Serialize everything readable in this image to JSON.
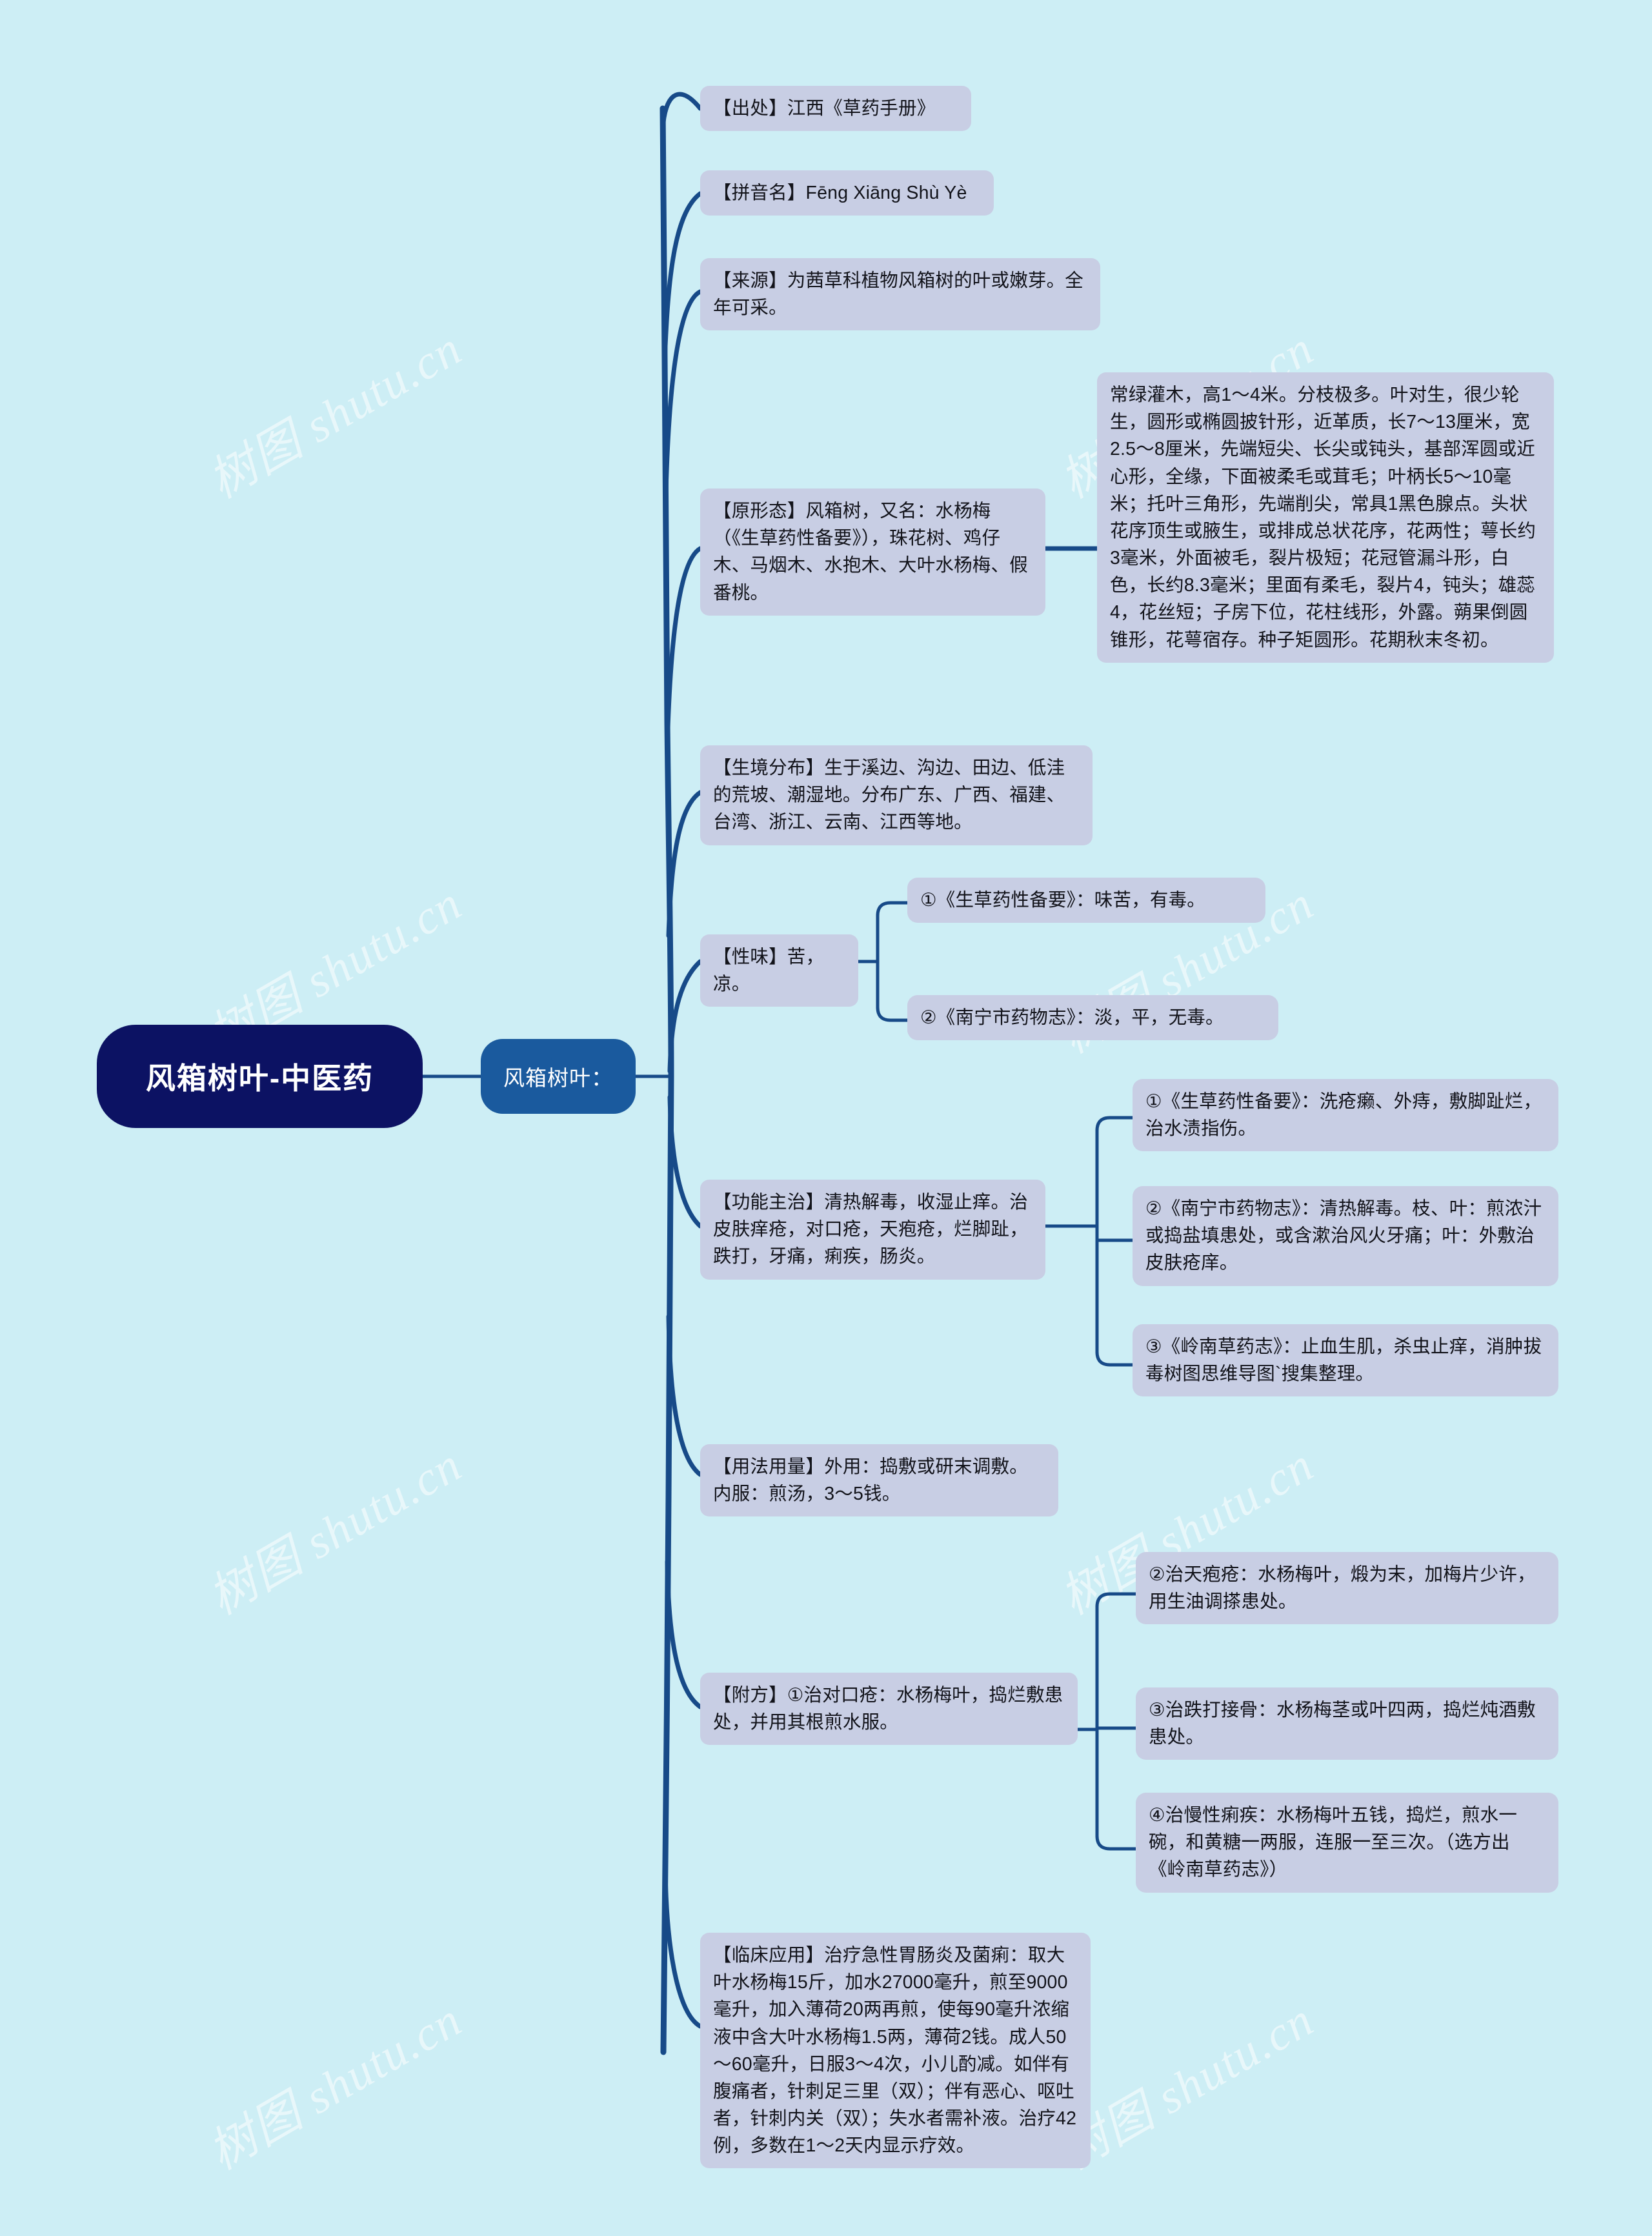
{
  "root": {
    "label": "风箱树叶-中医药"
  },
  "branch": {
    "label": "风箱树叶："
  },
  "watermarks": [
    "树图 shutu.cn",
    "树图 shutu.cn",
    "树图 shutu.cn",
    "树图 shutu.cn",
    "树图 shutu.cn",
    "树图 shutu.cn",
    "树图 shutu.cn",
    "树图 shutu.cn"
  ],
  "colors": {
    "background": "#cdeef5",
    "root_fill": "#0c1263",
    "branch_fill": "#1a5a9e",
    "node_fill": "#c8cee4",
    "link_stroke": "#174a88",
    "text": "#12131a"
  },
  "nodes": {
    "chuchu": "【出处】江西《草药手册》",
    "pinyin": "【拼音名】Fēng Xiāng Shù Yè",
    "laiyuan": "【来源】为茜草科植物风箱树的叶或嫩芽。全年可采。",
    "xingtai": "【原形态】风箱树，又名：水杨梅（《生草药性备要》），珠花树、鸡仔木、马烟木、水抱木、大叶水杨梅、假番桃。",
    "xingtai_detail": "常绿灌木，高1～4米。分枝极多。叶对生，很少轮生，圆形或椭圆披针形，近革质，长7～13厘米，宽2.5～8厘米，先端短尖、长尖或钝头，基部浑圆或近心形，全缘，下面被柔毛或茸毛；叶柄长5～10毫米；托叶三角形，先端削尖，常具1黑色腺点。头状花序顶生或腋生，或排成总状花序，花两性；萼长约3毫米，外面被毛，裂片极短；花冠管漏斗形，白色，长约8.3毫米；里面有柔毛，裂片4，钝头；雄蕊4，花丝短；子房下位，花柱线形，外露。蒴果倒圆锥形，花萼宿存。种子矩圆形。花期秋末冬初。",
    "shengjing": "【生境分布】生于溪边、沟边、田边、低洼的荒坡、潮湿地。分布广东、广西、福建、台湾、浙江、云南、江西等地。",
    "xingwei": "【性味】苦，凉。",
    "xingwei_1": "①《生草药性备要》：味苦，有毒。",
    "xingwei_2": "②《南宁市药物志》：淡，平，无毒。",
    "gongneng": "【功能主治】清热解毒，收湿止痒。治皮肤痒疮，对口疮，天疱疮，烂脚趾，跌打，牙痛，痢疾，肠炎。",
    "gongneng_1": "①《生草药性备要》：洗疮癞、外痔，敷脚趾烂，治水渍指伤。",
    "gongneng_2": "②《南宁市药物志》：清热解毒。枝、叶：煎浓汁或捣盐填患处，或含漱治风火牙痛；叶：外敷治皮肤疮庠。",
    "gongneng_3": "③《岭南草药志》：止血生肌，杀虫止痒，消肿拔毒树图思维导图`搜集整理。",
    "yongfa": "【用法用量】外用：捣敷或研末调敷。内服：煎汤，3～5钱。",
    "fufang": "【附方】①治对口疮：水杨梅叶，捣烂敷患处，并用其根煎水服。",
    "fufang_2": "②治天疱疮：水杨梅叶，煅为末，加梅片少许，用生油调搽患处。",
    "fufang_3": "③治跌打接骨：水杨梅茎或叶四两，捣烂炖酒敷患处。",
    "fufang_4": "④治慢性痢疾：水杨梅叶五钱，捣烂，煎水一碗，和黄糖一两服，连服一至三次。（选方出《岭南草药志》）",
    "linchuang": "【临床应用】治疗急性胃肠炎及菌痢：取大叶水杨梅15斤，加水27000毫升，煎至9000毫升，加入薄荷20两再煎，使每90毫升浓缩液中含大叶水杨梅1.5两，薄荷2钱。成人50～60毫升，日服3～4次，小儿酌减。如伴有腹痛者，针刺足三里（双）；伴有恶心、呕吐者，针刺内关（双）；失水者需补液。治疗42例，多数在1～2天内显示疗效。"
  }
}
